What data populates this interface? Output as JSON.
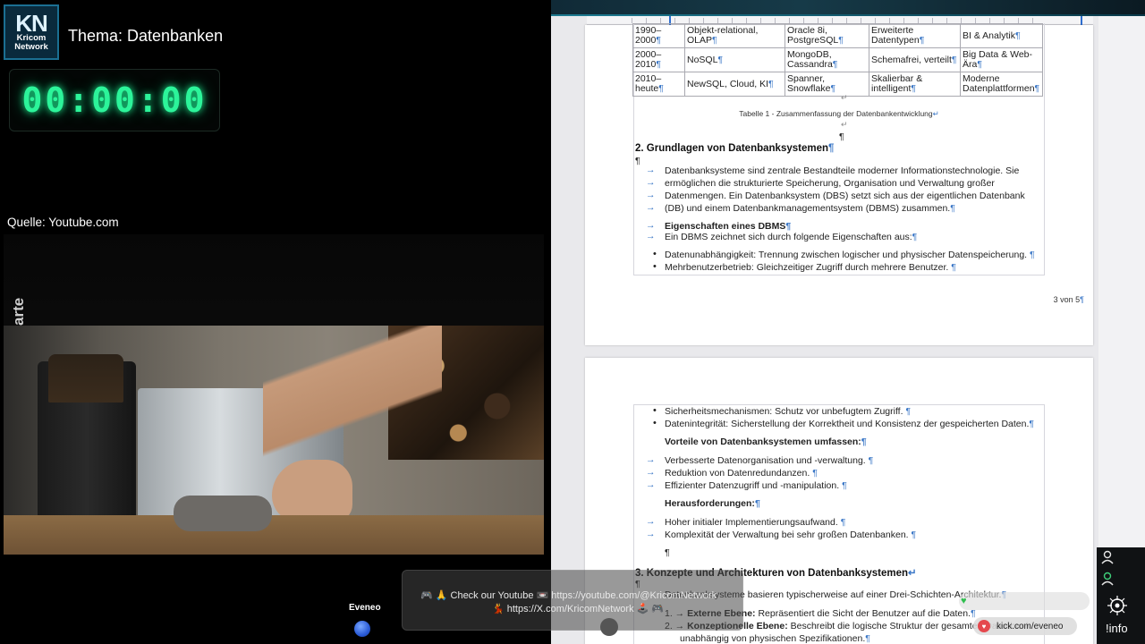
{
  "stream": {
    "logo_main": "KN",
    "logo_sub": "Kricom\nNetwork",
    "topic": "Thema: Datenbanken",
    "timer": "00:00:00",
    "source": "Quelle: Youtube.com",
    "video_watermark": "arte",
    "banner_line1": "🎮 🙏 Check our Youtube 📼 https://youtube.com/@KricomNetwork",
    "banner_line2": "💃 https://X.com/KricomNetwork 🕹️ 🎮",
    "left_label": "Eveneo",
    "pill_eveneo": "kick.com/eveneo",
    "info_label": "!info"
  },
  "document": {
    "table_rows": [
      [
        "1990–2000¶",
        "Objekt-relational, OLAP¶",
        "Oracle 8i, PostgreSQL¶",
        "Erweiterte Datentypen¶",
        "BI & Analytik¶"
      ],
      [
        "2000–2010¶",
        "NoSQL¶",
        "MongoDB, Cassandra¶",
        "Schemafrei, verteilt¶",
        "Big Data & Web-Ära¶"
      ],
      [
        "2010–heute¶",
        "NewSQL, Cloud, KI¶",
        "Spanner, Snowflake¶",
        "Skalierbar & intelligent¶",
        "Moderne Datenplattformen¶"
      ]
    ],
    "caption": "Tabelle 1 - Zusammenfassung der Datenbankentwicklung↵",
    "section2_heading": "2. Grundlagen von Datenbanksystemen¶",
    "para1_lines": [
      "Datenbanksysteme sind zentrale Bestandteile moderner Informationstechnologie. Sie",
      "ermöglichen die strukturierte Speicherung, Organisation und Verwaltung großer",
      "Datenmengen. Ein Datenbanksystem (DBS) setzt sich aus der eigentlichen Datenbank",
      "(DB) und einem Datenbankmanagementsystem (DBMS) zusammen.¶"
    ],
    "dbms_heading": "Eigenschaften eines DBMS¶",
    "dbms_intro": "Ein DBMS zeichnet sich durch folgende Eigenschaften aus:¶",
    "bullets_page1": [
      "Datenunabhängigkeit: Trennung zwischen logischer und physischer Datenspeicherung. ¶",
      "Mehrbenutzerbetrieb: Gleichzeitiger Zugriff durch mehrere Benutzer. ¶"
    ],
    "page_number": "3 von 5¶",
    "bullets_page2": [
      "Sicherheitsmechanismen: Schutz vor unbefugtem Zugriff. ¶",
      "Datenintegrität: Sicherstellung der Korrektheit und Konsistenz der gespeicherten Daten.¶"
    ],
    "vorteile_heading": "Vorteile von Datenbanksystemen umfassen:¶",
    "vorteile_items": [
      "Verbesserte Datenorganisation und -verwaltung. ¶",
      "Reduktion von Datenredundanzen. ¶",
      "Effizienter Datenzugriff und -manipulation. ¶"
    ],
    "heraus_heading": "Herausforderungen:¶",
    "heraus_items": [
      "Hoher initialer Implementierungsaufwand. ¶",
      "Komplexität der Verwaltung bei sehr großen Datenbanken. ¶"
    ],
    "section3_heading": "3. Konzepte und Architekturen von Datenbanksystemen↵",
    "section3_intro": "Datenbanksysteme basieren typischerweise auf einer Drei-Schichten-Architektur.¶",
    "numbered": [
      {
        "label": "Externe Ebene:",
        "text": " Repräsentiert die Sicht der Benutzer auf die Daten.¶"
      },
      {
        "label": "Konzeptionelle Ebene:",
        "text": " Beschreibt die logische Struktur der gesamten Datenbank"
      }
    ],
    "numbered_cont": "unabhängig von physischen Spezifikationen.¶",
    "pilcrow": "¶",
    "return_mark": "↵"
  },
  "colors": {
    "timer_green": "#2cf49a",
    "formatting_marks": "#3c78c7",
    "accent_blue": "#1b6f92"
  },
  "icons": [
    "user-icon",
    "user-green-icon",
    "info-logo-icon",
    "heart-icon",
    "green-heart-icon"
  ]
}
